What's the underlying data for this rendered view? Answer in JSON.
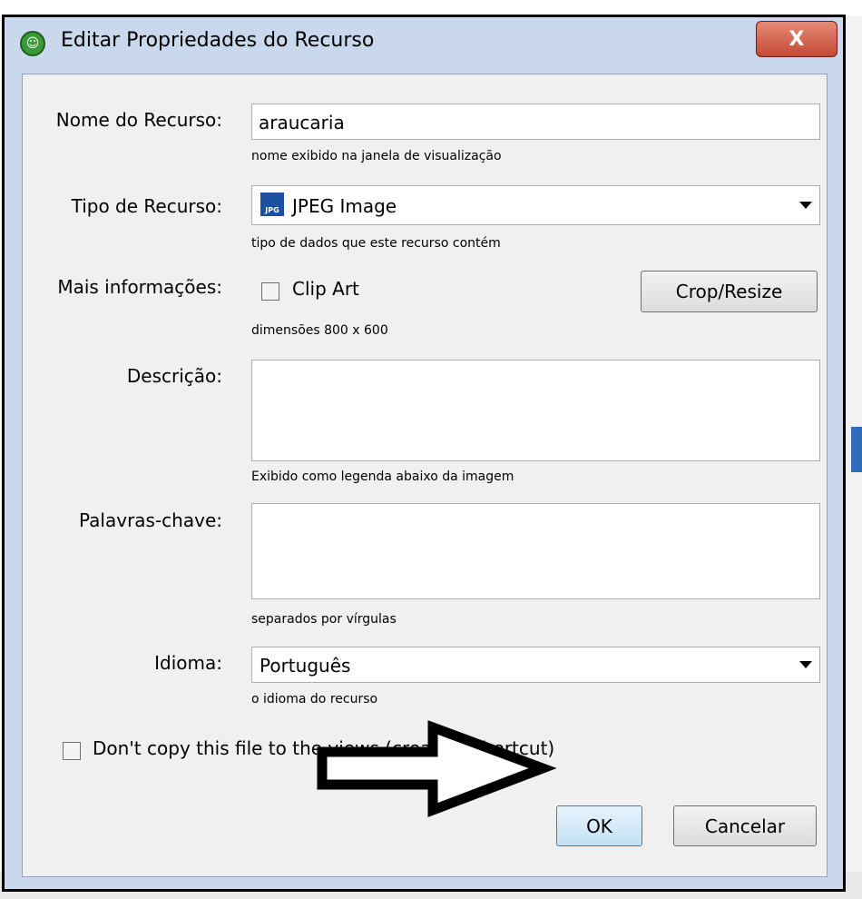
{
  "window": {
    "title": "Editar Propriedades do Recurso",
    "close_glyph": "X"
  },
  "form": {
    "name": {
      "label": "Nome do Recurso:",
      "value": "araucaria",
      "hint": "nome exibido na janela de visualização"
    },
    "type": {
      "label": "Tipo de Recurso:",
      "value": "JPEG Image",
      "icon_text": "JPG",
      "hint": "tipo de dados que este recurso contém"
    },
    "more_info": {
      "label": "Mais informações:",
      "clipart_label": "Clip Art",
      "clipart_checked": false,
      "crop_button": "Crop/Resize",
      "dimensions": "dimensões 800 x 600"
    },
    "description": {
      "label": "Descrição:",
      "value": "",
      "hint": "Exibido como legenda abaixo da imagem"
    },
    "keywords": {
      "label": "Palavras-chave:",
      "value": "",
      "hint": "separados por vírgulas"
    },
    "language": {
      "label": "Idioma:",
      "value": "Português",
      "hint": "o idioma do recurso"
    },
    "shortcut": {
      "label": "Don't copy this file to the views (create a shortcut)",
      "checked": false
    }
  },
  "buttons": {
    "ok": "OK",
    "cancel": "Cancelar"
  },
  "colors": {
    "accent": "#3c7fb1",
    "close": "#c44a35"
  }
}
